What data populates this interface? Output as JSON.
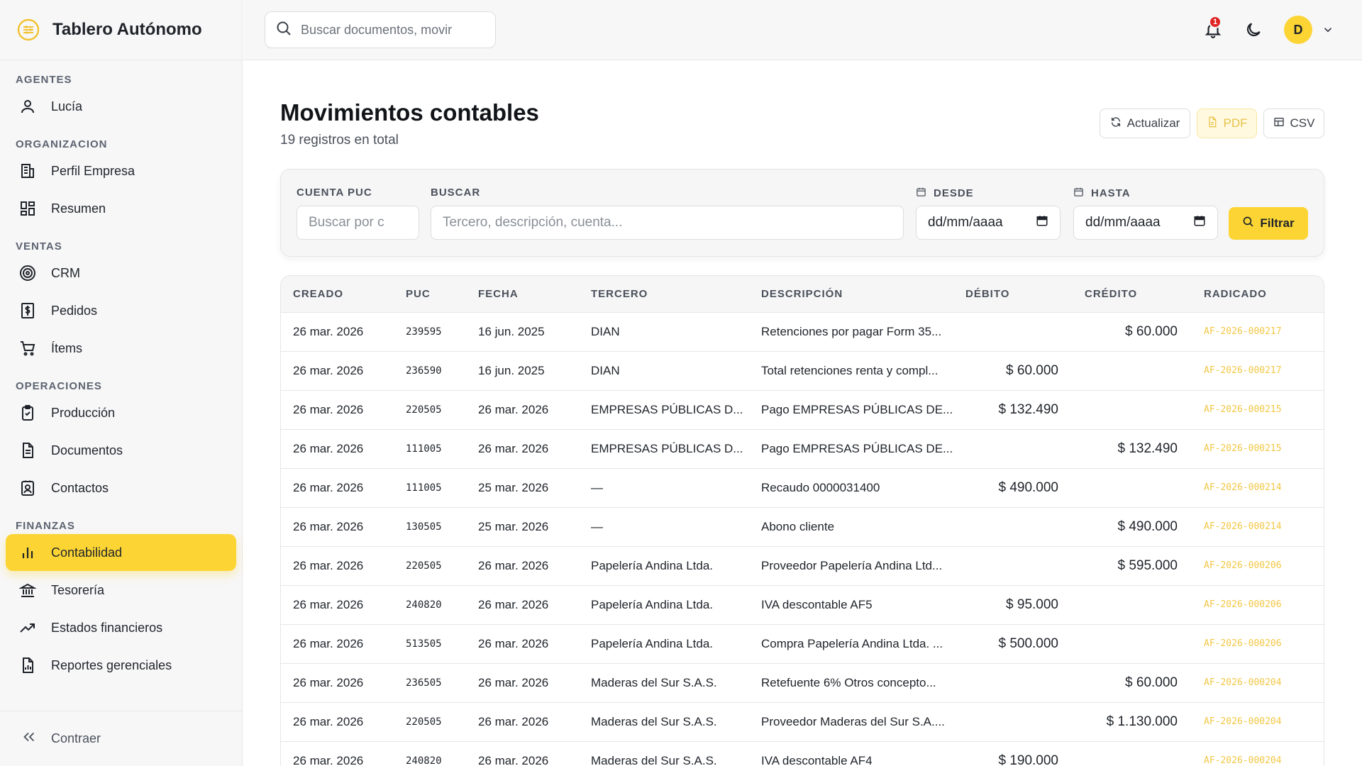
{
  "app": {
    "title": "Tablero Autónomo",
    "logo_icon": "sliders-coin-icon",
    "accent": "#fcd535"
  },
  "sidebar": {
    "sections": [
      {
        "label": "AGENTES",
        "items": [
          {
            "label": "Lucía",
            "icon": "user-icon"
          }
        ]
      },
      {
        "label": "ORGANIZACION",
        "items": [
          {
            "label": "Perfil Empresa",
            "icon": "building-icon"
          },
          {
            "label": "Resumen",
            "icon": "dashboard-icon"
          }
        ]
      },
      {
        "label": "VENTAS",
        "items": [
          {
            "label": "CRM",
            "icon": "target-icon"
          },
          {
            "label": "Pedidos",
            "icon": "invoice-dollar-icon"
          },
          {
            "label": "Ítems",
            "icon": "cart-icon"
          }
        ]
      },
      {
        "label": "OPERACIONES",
        "items": [
          {
            "label": "Producción",
            "icon": "clipboard-check-icon"
          },
          {
            "label": "Documentos",
            "icon": "document-icon"
          },
          {
            "label": "Contactos",
            "icon": "contact-card-icon"
          }
        ]
      },
      {
        "label": "FINANZAS",
        "items": [
          {
            "label": "Contabilidad",
            "icon": "bar-chart-icon",
            "active": true
          },
          {
            "label": "Tesorería",
            "icon": "bank-icon"
          },
          {
            "label": "Estados financieros",
            "icon": "trend-up-icon"
          },
          {
            "label": "Reportes gerenciales",
            "icon": "report-icon"
          }
        ]
      }
    ],
    "collapse_label": "Contraer"
  },
  "topbar": {
    "search_placeholder": "Buscar documentos, movir",
    "notifications_count": "1",
    "avatar_initial": "D"
  },
  "page": {
    "title": "Movimientos contables",
    "subtitle": "19 registros en total",
    "actions": {
      "refresh": "Actualizar",
      "pdf": "PDF",
      "csv": "CSV"
    }
  },
  "filters": {
    "cuenta_label": "CUENTA PUC",
    "cuenta_placeholder": "Buscar por c",
    "buscar_label": "BUSCAR",
    "buscar_placeholder": "Tercero, descripción, cuenta...",
    "desde_label": "DESDE",
    "desde_value": "dd/mm/aaaa",
    "hasta_label": "HASTA",
    "hasta_value": "dd/mm/aaaa",
    "filter_button": "Filtrar"
  },
  "table": {
    "columns": [
      "CREADO",
      "PUC",
      "FECHA",
      "TERCERO",
      "DESCRIPCIÓN",
      "DÉBITO",
      "CRÉDITO",
      "RADICADO"
    ],
    "rows": [
      {
        "creado": "26 mar. 2026",
        "puc": "239595",
        "fecha": "16 jun. 2025",
        "tercero": "DIAN",
        "descripcion": "Retenciones por pagar Form 35...",
        "debito": "",
        "credito": "$ 60.000",
        "radicado": "AF-2026-000217"
      },
      {
        "creado": "26 mar. 2026",
        "puc": "236590",
        "fecha": "16 jun. 2025",
        "tercero": "DIAN",
        "descripcion": "Total retenciones renta y compl...",
        "debito": "$ 60.000",
        "credito": "",
        "radicado": "AF-2026-000217"
      },
      {
        "creado": "26 mar. 2026",
        "puc": "220505",
        "fecha": "26 mar. 2026",
        "tercero": "EMPRESAS PÚBLICAS D...",
        "descripcion": "Pago EMPRESAS PÚBLICAS DE...",
        "debito": "$ 132.490",
        "credito": "",
        "radicado": "AF-2026-000215"
      },
      {
        "creado": "26 mar. 2026",
        "puc": "111005",
        "fecha": "26 mar. 2026",
        "tercero": "EMPRESAS PÚBLICAS D...",
        "descripcion": "Pago EMPRESAS PÚBLICAS DE...",
        "debito": "",
        "credito": "$ 132.490",
        "radicado": "AF-2026-000215"
      },
      {
        "creado": "26 mar. 2026",
        "puc": "111005",
        "fecha": "25 mar. 2026",
        "tercero": "—",
        "descripcion": "Recaudo 0000031400",
        "debito": "$ 490.000",
        "credito": "",
        "radicado": "AF-2026-000214"
      },
      {
        "creado": "26 mar. 2026",
        "puc": "130505",
        "fecha": "25 mar. 2026",
        "tercero": "—",
        "descripcion": "Abono cliente",
        "debito": "",
        "credito": "$ 490.000",
        "radicado": "AF-2026-000214"
      },
      {
        "creado": "26 mar. 2026",
        "puc": "220505",
        "fecha": "26 mar. 2026",
        "tercero": "Papelería Andina Ltda.",
        "descripcion": "Proveedor Papelería Andina Ltd...",
        "debito": "",
        "credito": "$ 595.000",
        "radicado": "AF-2026-000206"
      },
      {
        "creado": "26 mar. 2026",
        "puc": "240820",
        "fecha": "26 mar. 2026",
        "tercero": "Papelería Andina Ltda.",
        "descripcion": "IVA descontable AF5",
        "debito": "$ 95.000",
        "credito": "",
        "radicado": "AF-2026-000206"
      },
      {
        "creado": "26 mar. 2026",
        "puc": "513505",
        "fecha": "26 mar. 2026",
        "tercero": "Papelería Andina Ltda.",
        "descripcion": "Compra Papelería Andina Ltda. ...",
        "debito": "$ 500.000",
        "credito": "",
        "radicado": "AF-2026-000206"
      },
      {
        "creado": "26 mar. 2026",
        "puc": "236505",
        "fecha": "26 mar. 2026",
        "tercero": "Maderas del Sur S.A.S.",
        "descripcion": "Retefuente 6% Otros concepto...",
        "debito": "",
        "credito": "$ 60.000",
        "radicado": "AF-2026-000204"
      },
      {
        "creado": "26 mar. 2026",
        "puc": "220505",
        "fecha": "26 mar. 2026",
        "tercero": "Maderas del Sur S.A.S.",
        "descripcion": "Proveedor Maderas del Sur S.A....",
        "debito": "",
        "credito": "$ 1.130.000",
        "radicado": "AF-2026-000204"
      },
      {
        "creado": "26 mar. 2026",
        "puc": "240820",
        "fecha": "26 mar. 2026",
        "tercero": "Maderas del Sur S.A.S.",
        "descripcion": "IVA descontable AF4",
        "debito": "$ 190.000",
        "credito": "",
        "radicado": "AF-2026-000204"
      }
    ]
  }
}
